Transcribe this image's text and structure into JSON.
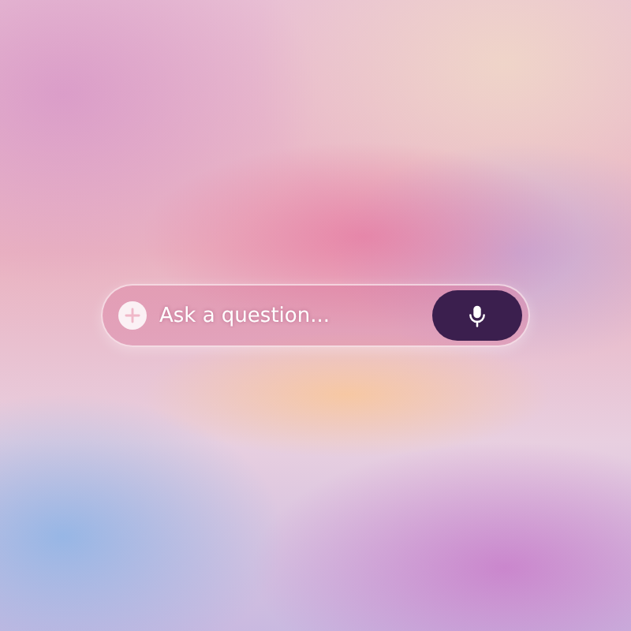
{
  "prompt_bar": {
    "placeholder": "Ask a question..."
  }
}
